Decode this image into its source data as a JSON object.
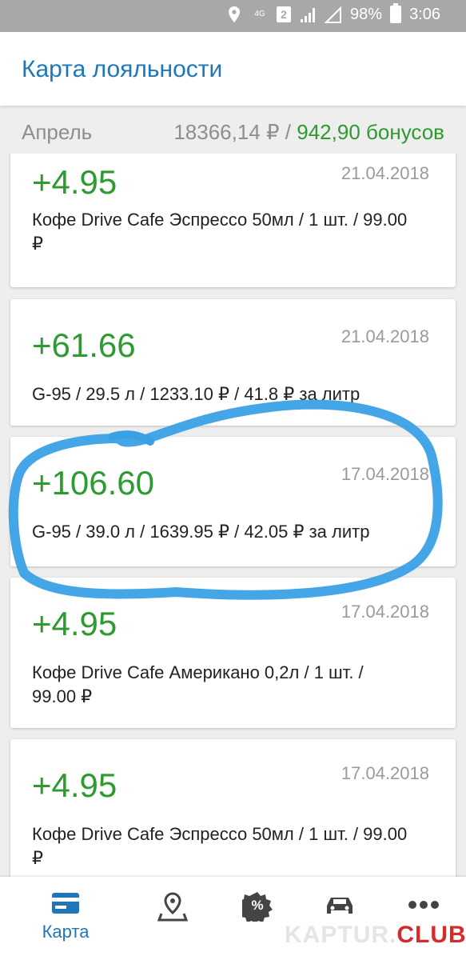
{
  "status_bar": {
    "network": "4G",
    "sim_badge": "2",
    "battery": "98%",
    "time": "3:06"
  },
  "app_bar": {
    "title": "Карта лояльности"
  },
  "summary": {
    "month": "Апрель",
    "amount": "18366,14 ₽",
    "separator": "/",
    "bonus": "942,90 бонусов"
  },
  "transactions": [
    {
      "bonus": "+4.95",
      "date": "21.04.2018",
      "description": "Кофе Drive Cafe Эспрессо 50мл / 1 шт. / 99.00 ₽"
    },
    {
      "bonus": "+61.66",
      "date": "21.04.2018",
      "description": "G-95 / 29.5 л / 1233.10 ₽ / 41.8 ₽ за литр"
    },
    {
      "bonus": "+106.60",
      "date": "17.04.2018",
      "description": "G-95 / 39.0 л / 1639.95 ₽ / 42.05 ₽ за литр"
    },
    {
      "bonus": "+4.95",
      "date": "17.04.2018",
      "description": "Кофе Drive Cafe Американо 0,2л / 1 шт. / 99.00 ₽"
    },
    {
      "bonus": "+4.95",
      "date": "17.04.2018",
      "description": "Кофе Drive Cafe Эспрессо 50мл / 1 шт. / 99.00 ₽"
    }
  ],
  "bottom_nav": {
    "card_label": "Карта",
    "promo_symbol": "%"
  },
  "watermark": {
    "main": "KAPTUR.",
    "accent": "CLUB"
  },
  "colors": {
    "accent_blue": "#1f77b8",
    "bonus_green": "#2d9b2f",
    "highlight_stroke": "#3aa0e6"
  }
}
